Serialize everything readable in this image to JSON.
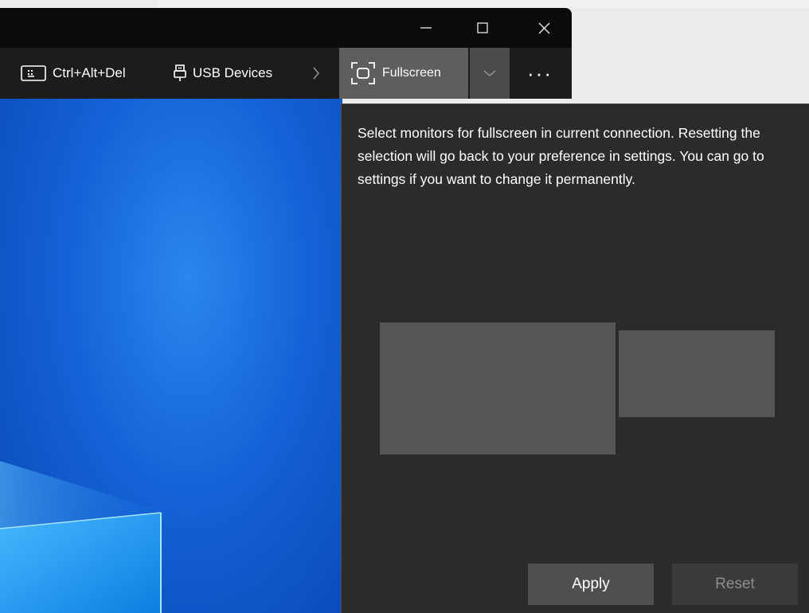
{
  "window": {
    "minimize_icon": "minimize-icon",
    "maximize_icon": "maximize-icon",
    "close_icon": "close-icon"
  },
  "toolbar": {
    "ctrl_alt_del_label": "Ctrl+Alt+Del",
    "usb_devices_label": "USB Devices",
    "fullscreen_label": "Fullscreen",
    "more_label": "···"
  },
  "flyout": {
    "description": "Select monitors for fullscreen in current connection. Resetting the selection will go back to your preference in settings. You can go to settings if you want to change it permanently.",
    "monitors": [
      {
        "name": "monitor-1"
      },
      {
        "name": "monitor-2"
      }
    ],
    "apply_label": "Apply",
    "reset_label": "Reset"
  },
  "colors": {
    "flyout_bg": "#2b2b2b",
    "toolbar_bg": "#1c1c1c",
    "titlebar_bg": "#0b0b0b",
    "desktop_blue": "#1463d6",
    "monitor_fill": "#555555"
  }
}
